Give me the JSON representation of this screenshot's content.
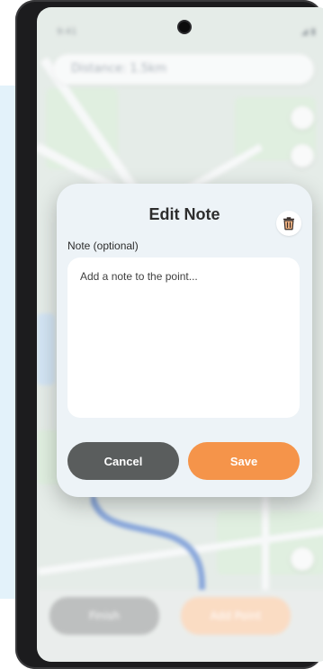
{
  "status": {
    "time": "9:41",
    "icons": "◢ ▮"
  },
  "map": {
    "search_text": "Distance: 1.5km"
  },
  "background_buttons": {
    "left": "Finish",
    "right": "Add Point"
  },
  "dialog": {
    "title": "Edit Note",
    "note_label": "Note (optional)",
    "note_placeholder": "Add a note to the point...",
    "note_value": "",
    "cancel_label": "Cancel",
    "save_label": "Save",
    "trash_icon": "trash-icon"
  },
  "colors": {
    "save": "#f5944a",
    "cancel": "#5a5d5d",
    "dialog_bg": "#edf3f7"
  }
}
